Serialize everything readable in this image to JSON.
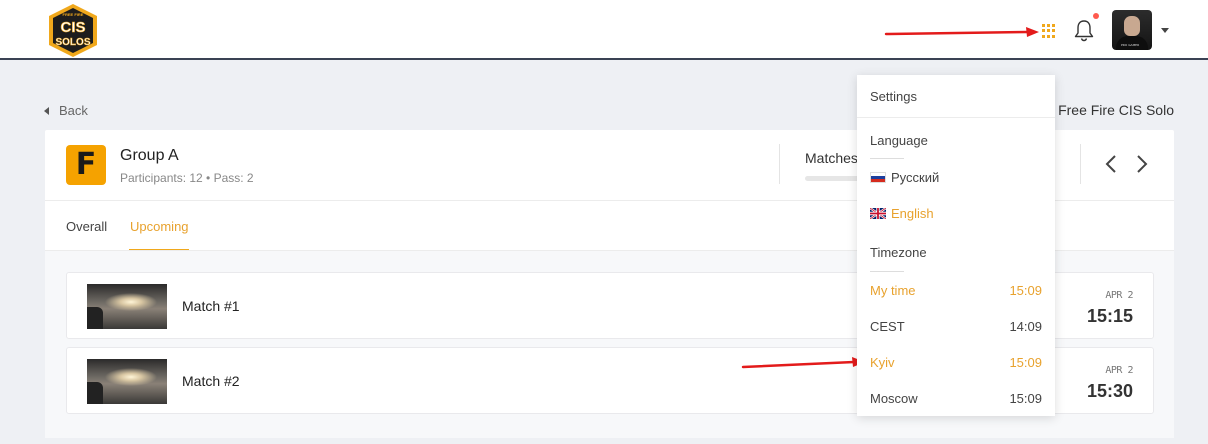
{
  "header": {
    "logo_text": "CIS SOLOS",
    "logo_small": "FREE FIRE",
    "avatar_tag": "PRO GAMER"
  },
  "icons": {
    "apps": "apps-grid-icon",
    "bell": "bell-icon",
    "back": "back-caret-icon",
    "prev": "chevron-left-icon",
    "next": "chevron-right-icon"
  },
  "colors": {
    "accent": "#f0a81c",
    "notification": "#ff5a4e",
    "arrow": "#e31b1b",
    "header_border": "#3a4254"
  },
  "breadcrumb": {
    "back_label": "Back",
    "tournament_title": "- Free Fire CIS Solo"
  },
  "group": {
    "logo_letter": "F",
    "title": "Group A",
    "meta": "Participants: 12 • Pass: 2",
    "matches_label": "Matches"
  },
  "tabs": [
    {
      "label": "Overall"
    },
    {
      "label": "Upcoming"
    }
  ],
  "matches": [
    {
      "name": "Match #1",
      "date": "APR 2",
      "time": "15:15"
    },
    {
      "name": "Match #2",
      "date": "APR 2",
      "time": "15:30"
    }
  ],
  "dropdown": {
    "settings": "Settings",
    "language_heading": "Language",
    "languages": [
      {
        "label": "Русский",
        "selected": false
      },
      {
        "label": "English",
        "selected": true
      }
    ],
    "timezone_heading": "Timezone",
    "timezones": [
      {
        "label": "My time",
        "time": "15:09",
        "selected": true
      },
      {
        "label": "CEST",
        "time": "14:09",
        "selected": false
      },
      {
        "label": "Kyiv",
        "time": "15:09",
        "selected": true
      },
      {
        "label": "Moscow",
        "time": "15:09",
        "selected": false
      }
    ]
  }
}
